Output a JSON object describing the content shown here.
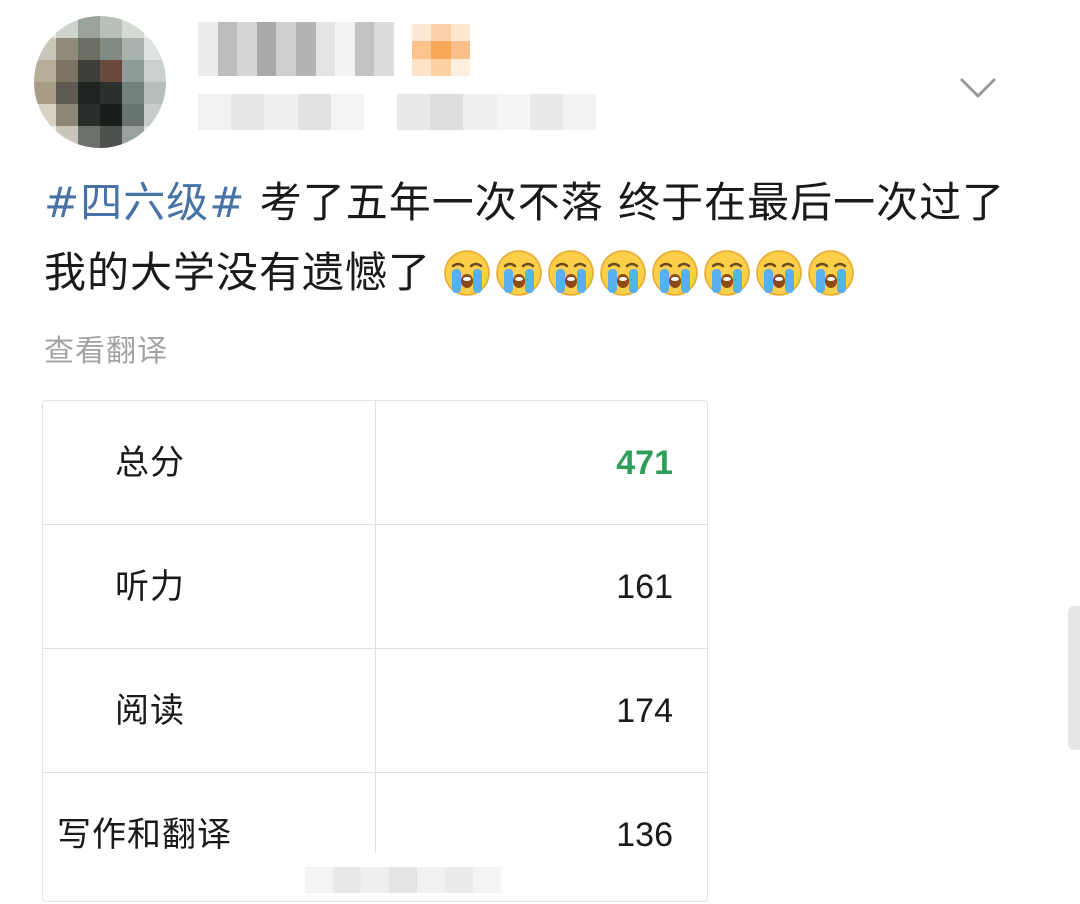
{
  "post": {
    "hashtag": "#四六级#",
    "text": " 考了五年一次不落 终于在最后一次过了 我的大学没有遗憾了",
    "emojis": [
      "loudly-crying-face",
      "loudly-crying-face",
      "loudly-crying-face",
      "loudly-crying-face",
      "loudly-crying-face",
      "loudly-crying-face",
      "loudly-crying-face",
      "loudly-crying-face"
    ],
    "translate_label": "查看翻译"
  },
  "score_card": {
    "rows": [
      {
        "label": "总分",
        "value": "471"
      },
      {
        "label": "听力",
        "value": "161"
      },
      {
        "label": "阅读",
        "value": "174"
      },
      {
        "label": "写作和翻译",
        "value": "136"
      }
    ]
  },
  "colors": {
    "hashtag": "#4873a6",
    "total_score": "#2e9e5a",
    "secondary_text": "#a3a3a3",
    "grid_line": "#e0e0e0"
  },
  "icons": {
    "menu": "chevron-down-icon",
    "emoji": "loudly-crying-face-icon"
  }
}
